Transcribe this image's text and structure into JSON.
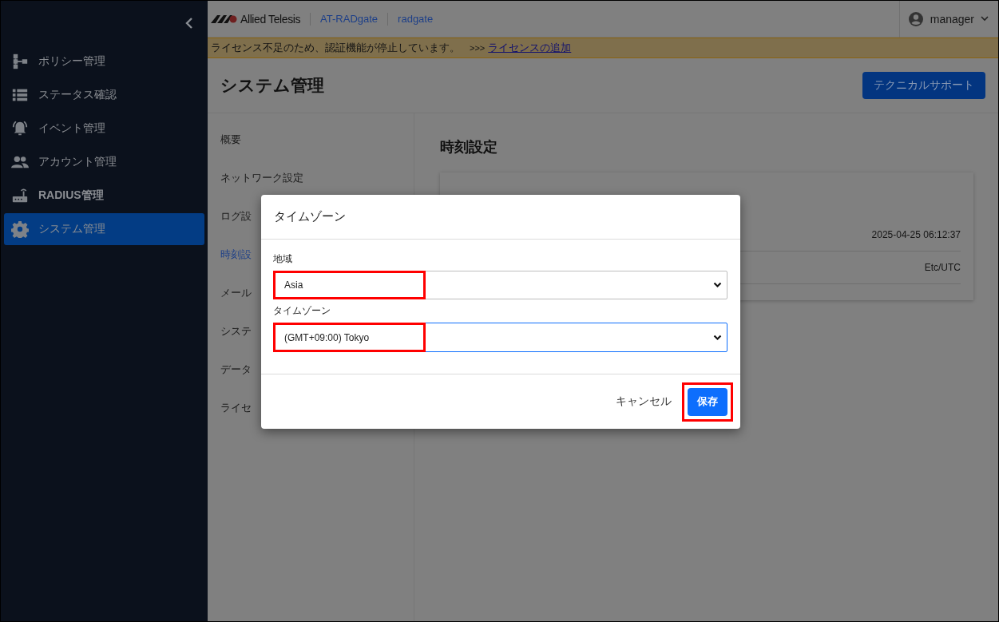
{
  "sidebar": {
    "items": [
      {
        "label": "ポリシー管理",
        "selected": false
      },
      {
        "label": "ステータス確認",
        "selected": false
      },
      {
        "label": "イベント管理",
        "selected": false
      },
      {
        "label": "アカウント管理",
        "selected": false
      },
      {
        "label": "RADIUS管理",
        "selected": false
      },
      {
        "label": "システム管理",
        "selected": true
      }
    ]
  },
  "header": {
    "brand": "Allied Telesis",
    "product": "AT-RADgate",
    "host": "radgate",
    "user": "manager"
  },
  "banner": {
    "message": "ライセンス不足のため、認証機能が停止しています。",
    "arrows": ">>>",
    "link": "ライセンスの追加"
  },
  "page": {
    "title": "システム管理",
    "support_button": "テクニカルサポート"
  },
  "submenu": [
    {
      "label": "概要",
      "selected": false
    },
    {
      "label": "ネットワーク設定",
      "selected": false
    },
    {
      "label": "ログ設",
      "selected": false
    },
    {
      "label": "時刻設",
      "selected": true
    },
    {
      "label": "メール",
      "selected": false
    },
    {
      "label": "システ",
      "selected": false
    },
    {
      "label": "データ",
      "selected": false
    },
    {
      "label": "ライセ",
      "selected": false
    }
  ],
  "section": {
    "title": "時刻設定",
    "rows": [
      {
        "value": "2025-04-25 06:12:37"
      },
      {
        "value": "Etc/UTC"
      }
    ]
  },
  "dialog": {
    "title": "タイムゾーン",
    "fields": [
      {
        "label": "地域",
        "value": "Asia",
        "focused": false,
        "highlighted": true
      },
      {
        "label": "タイムゾーン",
        "value": "(GMT+09:00) Tokyo",
        "focused": true,
        "highlighted": true
      }
    ],
    "cancel": "キャンセル",
    "save": {
      "label": "保存",
      "highlighted": true
    }
  }
}
